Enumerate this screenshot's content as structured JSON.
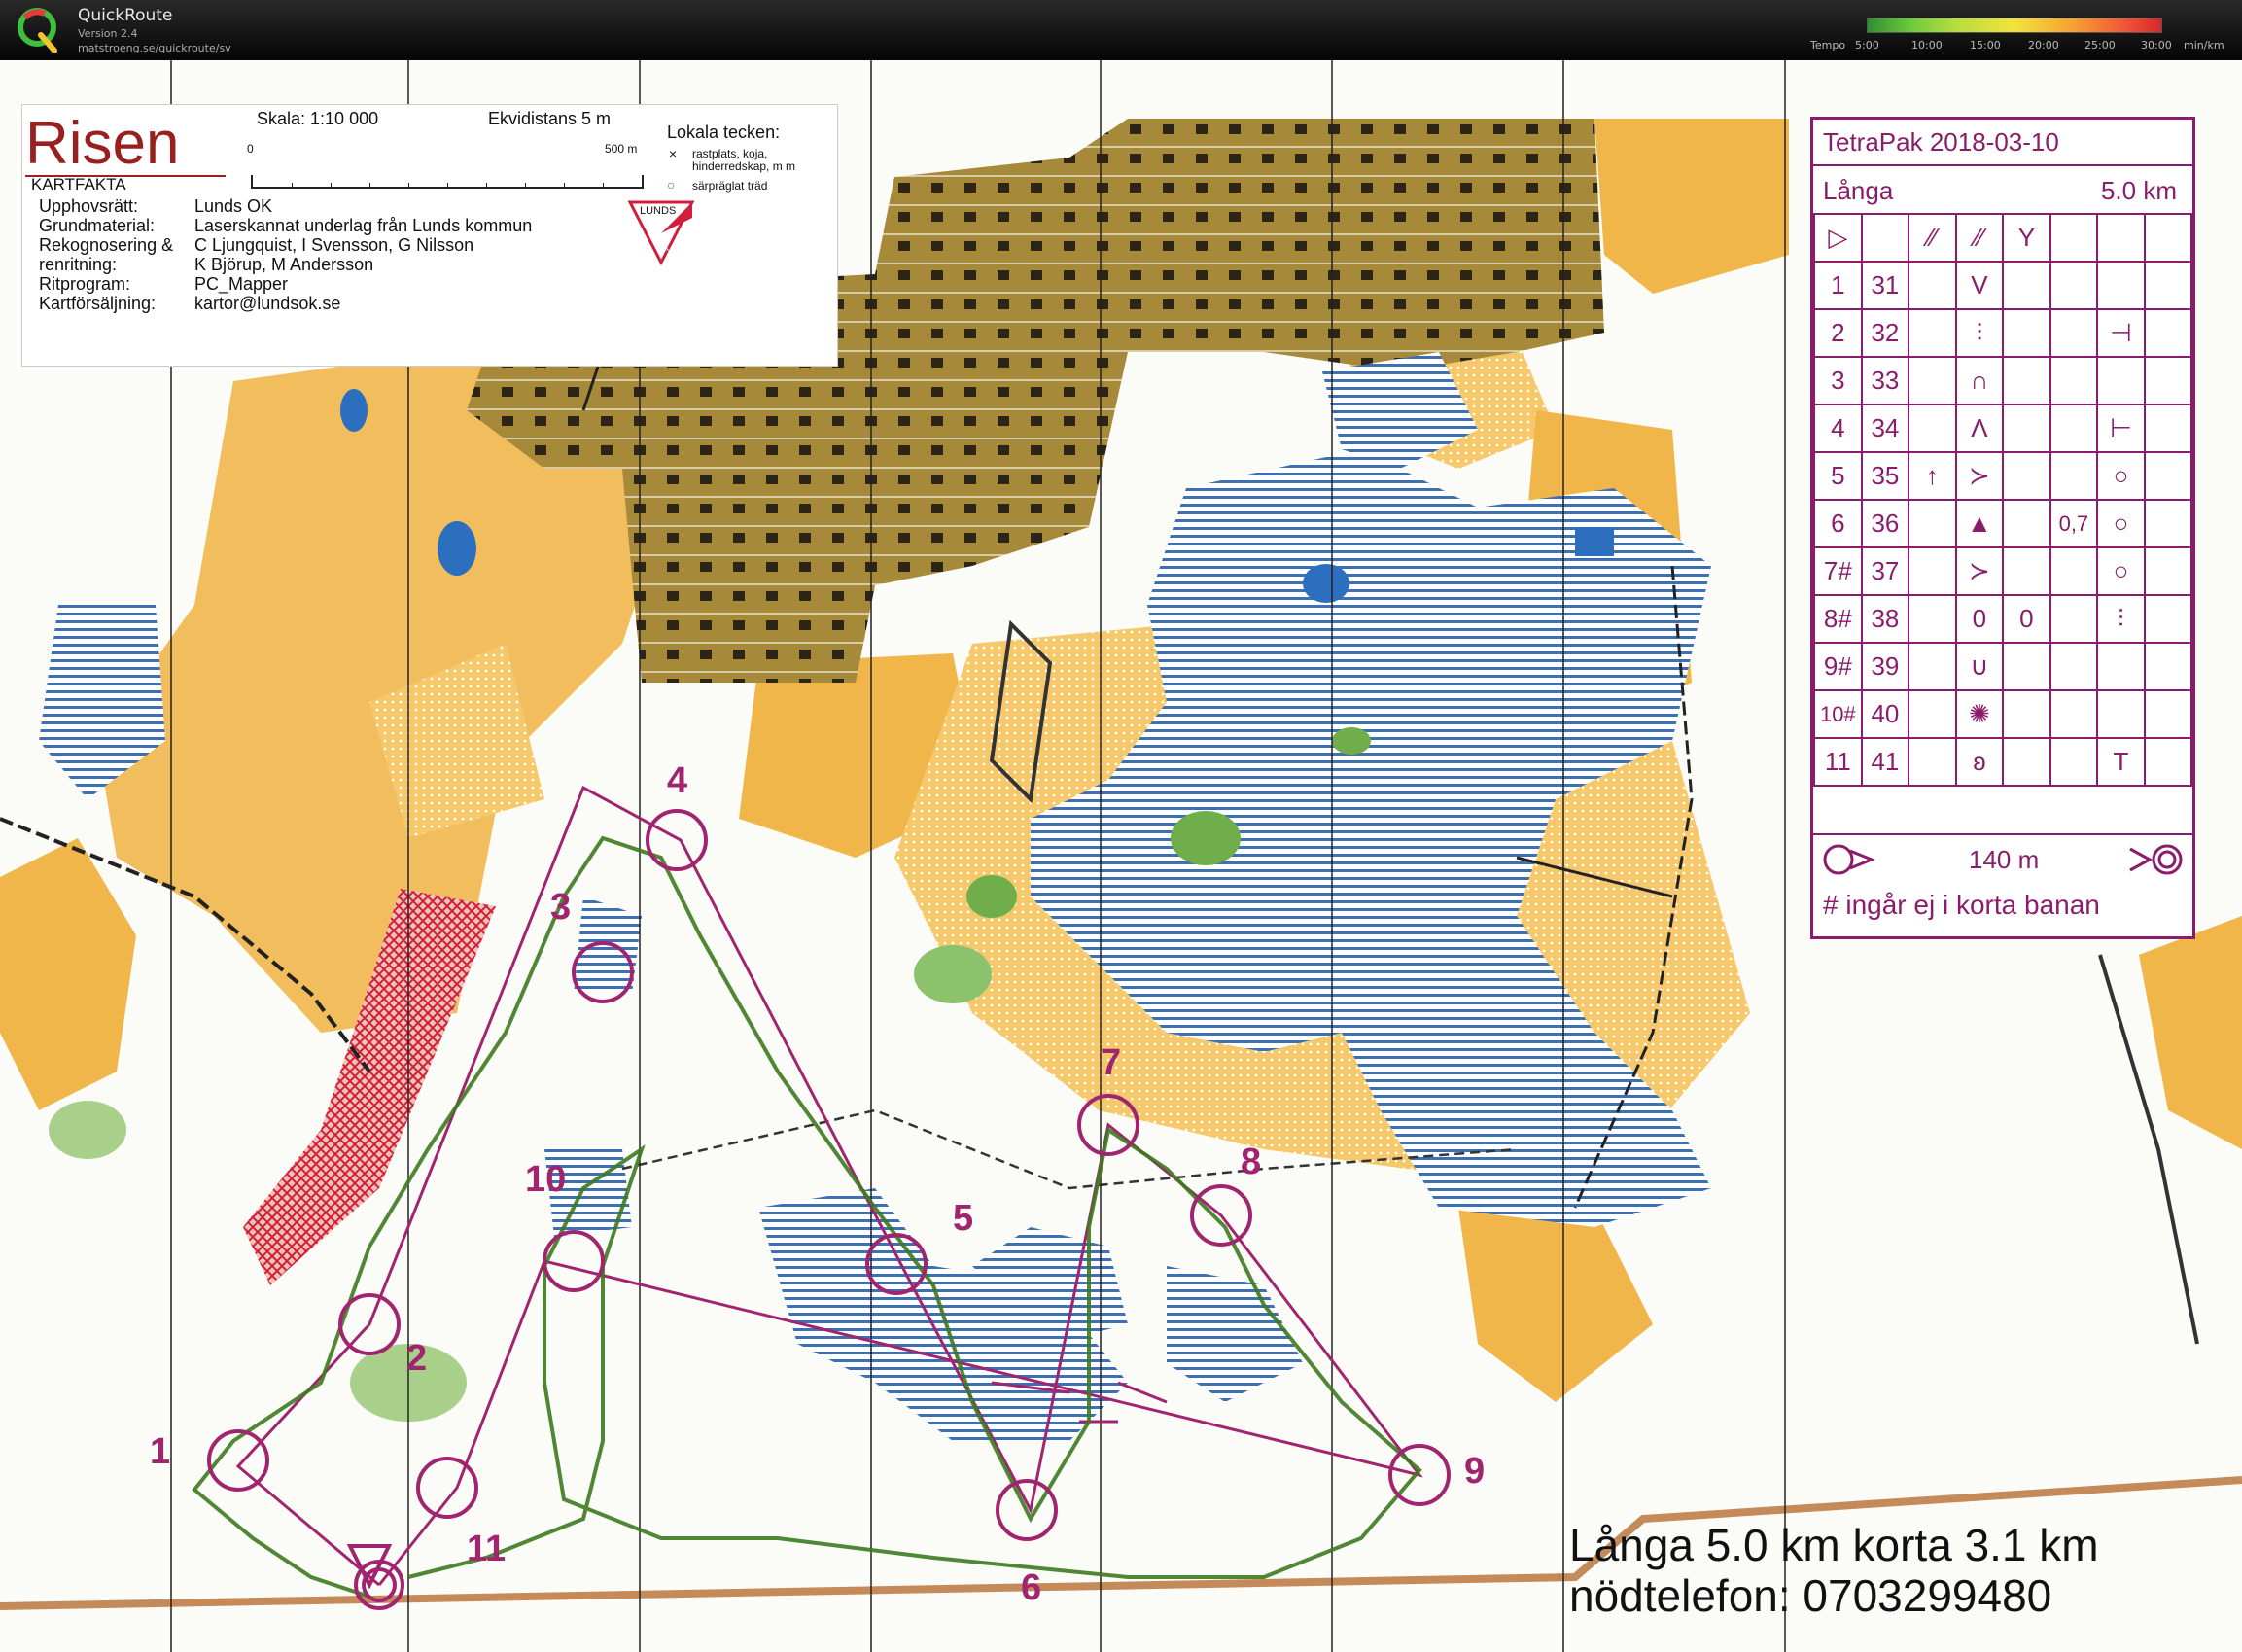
{
  "app": {
    "name": "QuickRoute",
    "version": "Version 2.4",
    "url": "matstroeng.se/quickroute/sv",
    "logo_icon": "quickroute-q-logo-icon"
  },
  "tempo_scale": {
    "label": "Tempo",
    "ticks": [
      "5:00",
      "10:00",
      "15:00",
      "20:00",
      "25:00",
      "30:00"
    ],
    "unit": "min/km",
    "colors": [
      "#2e8f2e",
      "#6ecb3c",
      "#f2e33b",
      "#f7a033",
      "#d62828"
    ]
  },
  "map": {
    "name": "Risen",
    "kartfakta": "KARTFAKTA",
    "scale": "Skala:  1:10 000",
    "equidistance": "Ekvidistans 5 m",
    "scale_start": "0",
    "scale_end": "500 m",
    "meta": [
      {
        "label": "Upphovsrätt:",
        "value": "Lunds OK"
      },
      {
        "label": "Grundmaterial:",
        "value": "Laserskannat underlag från Lunds kommun"
      },
      {
        "label": "Rekognosering &",
        "value": "C Ljungquist, I Svensson, G Nilsson"
      },
      {
        "label": "renritning:",
        "value": "K Björup, M Andersson"
      },
      {
        "label": "Ritprogram:",
        "value": "PC_Mapper"
      },
      {
        "label": "Kartförsäljning:",
        "value": "kartor@lundsok.se"
      }
    ],
    "local_symbols_title": "Lokala tecken:",
    "local_symbols": [
      "rastplats, koja, hinderredskap, m m",
      "särpräglat träd"
    ],
    "club_logo_text": "LUNDS OK"
  },
  "description_sheet": {
    "title": "TetraPak 2018-03-10",
    "course": "Långa",
    "length": "5.0 km",
    "start_row": [
      "▷",
      "",
      "⁄⁄",
      "⁄⁄",
      "Y",
      "",
      "",
      ""
    ],
    "rows": [
      [
        "1",
        "31",
        "",
        "V",
        "",
        "",
        "",
        ""
      ],
      [
        "2",
        "32",
        "",
        "⫶",
        "",
        "",
        "⊣",
        ""
      ],
      [
        "3",
        "33",
        "",
        "∩",
        "",
        "",
        "",
        ""
      ],
      [
        "4",
        "34",
        "",
        "Λ",
        "",
        "",
        "⊢",
        ""
      ],
      [
        "5",
        "35",
        "↑",
        "≻",
        "",
        "",
        "○",
        ""
      ],
      [
        "6",
        "36",
        "",
        "▲",
        "",
        "0,7",
        "○",
        ""
      ],
      [
        "7#",
        "37",
        "",
        "≻",
        "",
        "",
        "○",
        ""
      ],
      [
        "8#",
        "38",
        "",
        "0",
        "0",
        "",
        "⫶",
        ""
      ],
      [
        "9#",
        "39",
        "",
        "∪",
        "",
        "",
        "",
        ""
      ],
      [
        "10#",
        "40",
        "",
        "✺",
        "",
        "",
        "",
        ""
      ],
      [
        "11",
        "41",
        "",
        "ʚ",
        "",
        "",
        "T",
        ""
      ]
    ],
    "finish_distance": "140 m",
    "note": "# ingår ej i korta banan"
  },
  "footer": {
    "line1": "Långa 5.0 km    korta 3.1 km",
    "line2": "nödtelefon: 0703299480"
  },
  "controls": [
    {
      "num": "1"
    },
    {
      "num": "2"
    },
    {
      "num": "3"
    },
    {
      "num": "4"
    },
    {
      "num": "5"
    },
    {
      "num": "6"
    },
    {
      "num": "7"
    },
    {
      "num": "8"
    },
    {
      "num": "9"
    },
    {
      "num": "10"
    },
    {
      "num": "11"
    }
  ],
  "colors": {
    "course": "#a1246f",
    "route": "#3d7a1e",
    "open_land": "#f1b64a",
    "urban": "#a68a3a",
    "marsh": "#3d6fb5",
    "forest_green": "#6fae4b"
  }
}
